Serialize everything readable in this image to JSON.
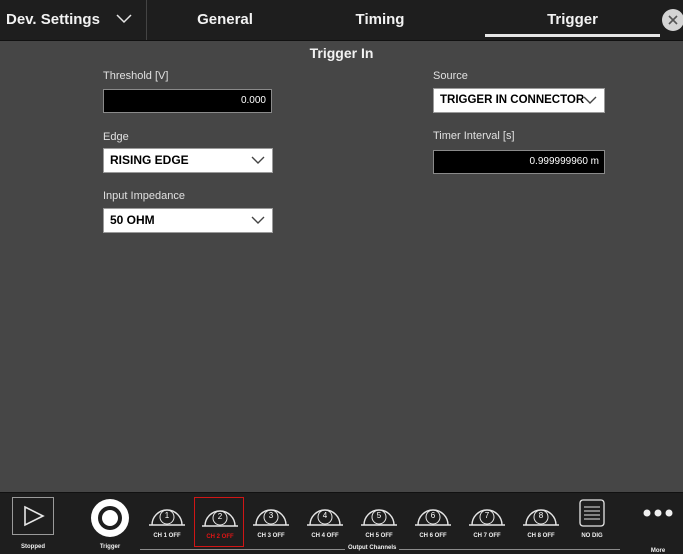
{
  "tabs": {
    "dev_settings": "Dev. Settings",
    "general": "General",
    "timing": "Timing",
    "trigger": "Trigger"
  },
  "section_title": "Trigger In",
  "threshold": {
    "label": "Threshold [V]",
    "value": "0.000"
  },
  "edge": {
    "label": "Edge",
    "value": "RISING EDGE"
  },
  "input_impedance": {
    "label": "Input Impedance",
    "value": "50 OHM"
  },
  "source": {
    "label": "Source",
    "value": "TRIGGER IN CONNECTOR"
  },
  "timer_interval": {
    "label": "Timer Interval [s]",
    "value": "0.999999960 m"
  },
  "bottom": {
    "stopped_label": "Stopped",
    "trigger_label": "Trigger",
    "output_channels_label": "Output Channels",
    "channels": [
      {
        "num": "1",
        "label": "CH 1 OFF"
      },
      {
        "num": "2",
        "label": "CH 2 OFF"
      },
      {
        "num": "3",
        "label": "CH 3 OFF"
      },
      {
        "num": "4",
        "label": "CH 4 OFF"
      },
      {
        "num": "5",
        "label": "CH 5 OFF"
      },
      {
        "num": "6",
        "label": "CH 6 OFF"
      },
      {
        "num": "7",
        "label": "CH 7 OFF"
      },
      {
        "num": "8",
        "label": "CH 8 OFF"
      }
    ],
    "nodig_label": "NO DIG",
    "more_label": "More"
  },
  "icons": {
    "chevron": "chevron-down-icon",
    "close": "close-icon",
    "play": "play-icon",
    "trigger": "trigger-ring-icon",
    "channel": "channel-dome-icon",
    "digital": "digital-module-icon",
    "more": "more-dots-icon"
  },
  "colors": {
    "background": "#464646",
    "bar": "#1e1e1e",
    "selected_channel": "#e01515"
  }
}
